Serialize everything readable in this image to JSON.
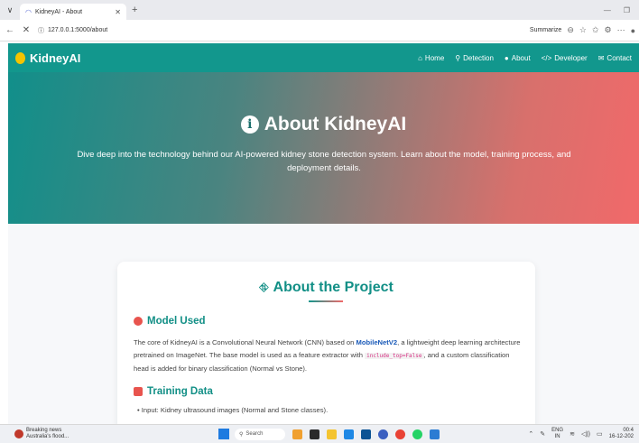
{
  "browser": {
    "tab_title": "KidneyAI - About",
    "url": "127.0.0.1:5000/about",
    "summarize": "Summarize"
  },
  "nav": {
    "brand": "KidneyAI",
    "links": [
      {
        "label": "Home",
        "icon": "home-icon"
      },
      {
        "label": "Detection",
        "icon": "search-icon"
      },
      {
        "label": "About",
        "icon": "info-icon"
      },
      {
        "label": "Developer",
        "icon": "code-icon"
      },
      {
        "label": "Contact",
        "icon": "envelope-icon"
      }
    ]
  },
  "hero": {
    "title": "About KidneyAI",
    "subtitle": "Dive deep into the technology behind our AI-powered kidney stone detection system. Learn about the model, training process, and deployment details."
  },
  "card": {
    "title": "About the Project",
    "model_heading": "Model Used",
    "model_text_1": "The core of KidneyAI is a Convolutional Neural Network (CNN) based on",
    "model_name": "MobileNetV2",
    "model_text_2": ", a lightweight deep learning architecture pretrained on ImageNet. The base model is used as a feature extractor with",
    "model_code": "include_top=False",
    "model_text_3": ", and a custom classification head is added for binary classification (Normal vs Stone).",
    "training_heading": "Training Data",
    "training_bullet": "Input: Kidney ultrasound images (Normal and Stone classes)."
  },
  "taskbar": {
    "weather_title": "Breaking news",
    "weather_sub": "Australia's flood...",
    "search": "Search",
    "lang_1": "ENG",
    "lang_2": "IN",
    "time": "00:4",
    "date": "16-12-202"
  },
  "colors": {
    "teal": "#12978d",
    "coral": "#f1696a"
  }
}
